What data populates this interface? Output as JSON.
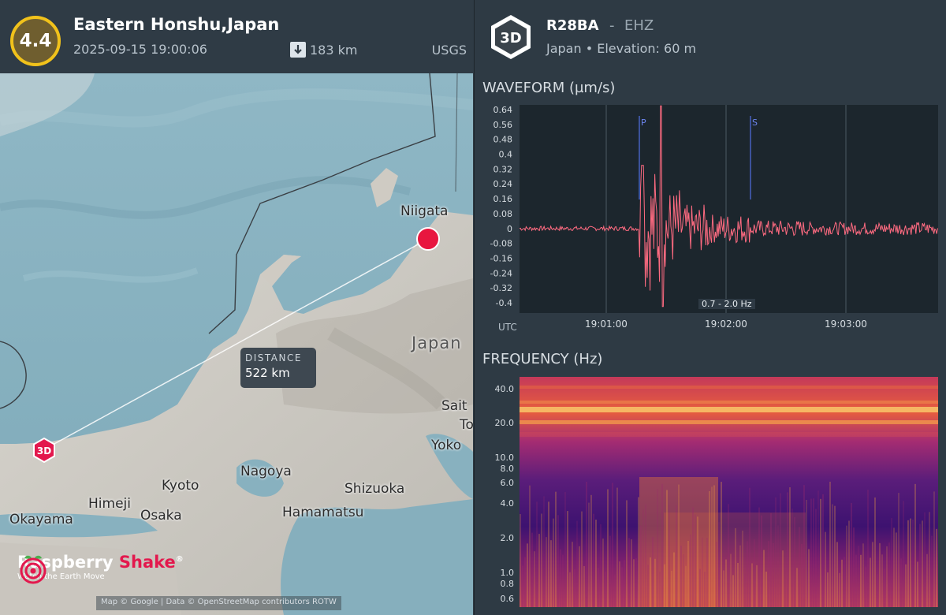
{
  "event": {
    "magnitude": "4.4",
    "title": "Eastern Honshu,Japan",
    "time": "2025-09-15 19:00:06",
    "depth": "183 km",
    "source": "USGS",
    "colors": {
      "badge_ring": "#f1c21b",
      "badge_fill": "#6f5e2f"
    }
  },
  "map": {
    "distance_label": "DISTANCE",
    "distance_value": "522 km",
    "station_marker": "3D",
    "cities": {
      "niigata": "Niigata",
      "japan": "Japan",
      "saitama": "Sait",
      "tokyo": "To",
      "yokohama": "Yoko",
      "kyoto": "Kyoto",
      "nagoya": "Nagoya",
      "himeji": "Himeji",
      "osaka": "Osaka",
      "okayama": "Okayama",
      "shizuoka": "Shizuoka",
      "hamamatsu": "Hamamatsu"
    },
    "attribution": "Map © Google | Data © OpenStreetMap contributors ROTW",
    "epicenter_color": "#e8163f"
  },
  "brand": {
    "name_part1": "Raspberry ",
    "name_part2": "Shake",
    "registered": "®",
    "tagline": "Watch the Earth Move"
  },
  "station": {
    "badge": "3D",
    "code": "R28BA",
    "separator": "-",
    "channel": "EHZ",
    "meta": "Japan • Elevation: 60 m"
  },
  "waveform": {
    "title": "WAVEFORM (µm/s)",
    "y_ticks": [
      "0.64",
      "0.56",
      "0.48",
      "0.4",
      "0.32",
      "0.24",
      "0.16",
      "0.08",
      "0",
      "-0.08",
      "-0.16",
      "-0.24",
      "-0.32",
      "-0.4"
    ],
    "x_ticks": [
      "19:01:00",
      "19:02:00",
      "19:03:00"
    ],
    "x_axis_label": "UTC",
    "p_label": "P",
    "s_label": "S",
    "filter": "0.7 - 2.0 Hz",
    "line_color": "#ff6b81"
  },
  "frequency": {
    "title": "FREQUENCY (Hz)",
    "y_ticks": [
      "40.0",
      "20.0",
      "10.0",
      "8.0",
      "6.0",
      "4.0",
      "2.0",
      "1.0",
      "0.8",
      "0.6"
    ]
  }
}
